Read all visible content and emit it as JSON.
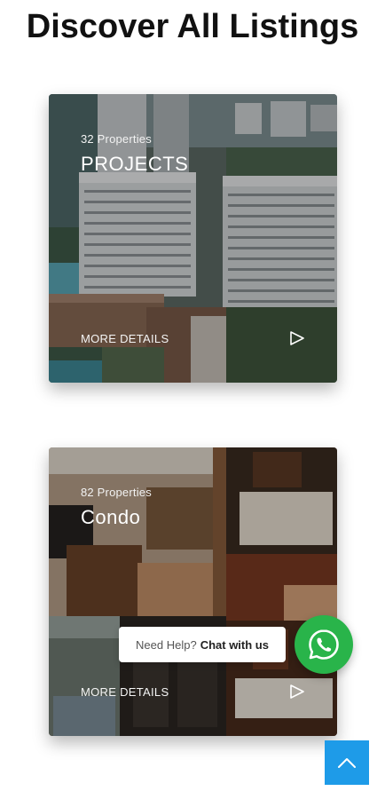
{
  "page": {
    "title": "Discover All Listings"
  },
  "cards": [
    {
      "count": "32 Properties",
      "title": "PROJECTS",
      "more": "MORE DETAILS"
    },
    {
      "count": "82 Properties",
      "title": "Condo",
      "more": "MORE DETAILS"
    }
  ],
  "chat": {
    "prefix": "Need Help?",
    "link": "Chat with us"
  },
  "icons": {
    "arrow": "play-triangle-outline-icon",
    "whatsapp": "whatsapp-icon",
    "scroll_top": "chevron-up-icon"
  },
  "colors": {
    "whatsapp": "#29b44a",
    "scroll_top": "#1e9be8",
    "title": "#111111"
  }
}
